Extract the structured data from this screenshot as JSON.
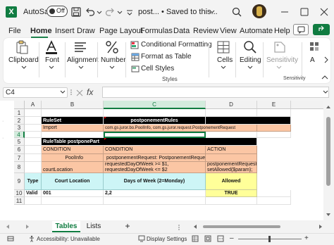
{
  "titlebar": {
    "autosave_label": "AutoSave",
    "autosave_state": "Off",
    "doc_title": "post... • Saved to this..."
  },
  "menu": {
    "items": [
      "File",
      "Home",
      "Insert",
      "Draw",
      "Page Layout",
      "Formulas",
      "Data",
      "Review",
      "View",
      "Automate",
      "Help"
    ],
    "active": "Home"
  },
  "ribbon": {
    "clipboard": "Clipboard",
    "font": "Font",
    "alignment": "Alignment",
    "number": "Number",
    "conditional_formatting": "Conditional Formatting",
    "format_as_table": "Format as Table",
    "cell_styles": "Cell Styles",
    "styles_group": "Styles",
    "cells": "Cells",
    "editing": "Editing",
    "sensitivity": "Sensitivity",
    "sensitivity_group": "Sensitivity",
    "addins": "A"
  },
  "formula_bar": {
    "name_box": "C4",
    "fx": "fx",
    "value": ""
  },
  "grid": {
    "columns": [
      "A",
      "B",
      "C",
      "D",
      "E"
    ],
    "rows": [
      "1",
      "2",
      "3",
      "4",
      "5",
      "6",
      "7",
      "8",
      "9",
      "10",
      "11"
    ],
    "cells": {
      "B2": "RuleSet",
      "C2": "postponementRules",
      "B3": "Import",
      "C3": "com.gs.juror.bo.PoolInfo, com.gs.juror.request.PostponementRequest",
      "B5": "RuleTable postponePart",
      "B6": "CONDITION",
      "C6": "CONDITION",
      "D6": "ACTION",
      "B7": "PoolInfo",
      "C7": "postponementRequest: PostponementRequest",
      "C8a": "requestedDayOfWeek >= $1,",
      "C8b": "requestedDayOfWeek <= $2",
      "D8a": "postponementRequest.",
      "D8b": "setAllowed($param);",
      "B8": "courtLocation",
      "A9": "Type",
      "B9": "Court Location",
      "C9": "Days of Week (2=Monday)",
      "D9": "Allowed",
      "A10": "Valid",
      "B10": "001",
      "C10": "2,2",
      "D10": "TRUE"
    }
  },
  "sheets": {
    "tabs": [
      "Tables",
      "Lists"
    ],
    "active": "Tables",
    "add": "+"
  },
  "status": {
    "accessibility": "Accessibility: Unavailable",
    "display_settings": "Display Settings"
  },
  "colors": {
    "accent": "#107c41",
    "header_black": "#000000",
    "orange": "#fbc6a4",
    "cyan": "#cdf5f6",
    "yellow": "#ffff99"
  }
}
